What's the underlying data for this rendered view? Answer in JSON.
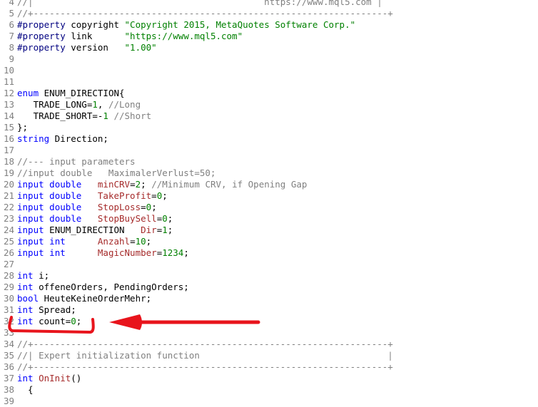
{
  "editor": {
    "lines": [
      {
        "n": "4",
        "segs": [
          {
            "t": "//|",
            "c": "cm"
          },
          {
            "t": "                                           https://www.mql5.com |",
            "c": "cm"
          }
        ]
      },
      {
        "n": "5",
        "segs": [
          {
            "t": "//+------------------------------------------------------------------+",
            "c": "cm"
          }
        ]
      },
      {
        "n": "6",
        "segs": [
          {
            "t": "#property",
            "c": "dir"
          },
          {
            "t": " copyright ",
            "c": ""
          },
          {
            "t": "\"Copyright 2015, MetaQuotes Software Corp.\"",
            "c": "str"
          }
        ]
      },
      {
        "n": "7",
        "segs": [
          {
            "t": "#property",
            "c": "dir"
          },
          {
            "t": " link      ",
            "c": ""
          },
          {
            "t": "\"https://www.mql5.com\"",
            "c": "str"
          }
        ]
      },
      {
        "n": "8",
        "segs": [
          {
            "t": "#property",
            "c": "dir"
          },
          {
            "t": " version   ",
            "c": ""
          },
          {
            "t": "\"1.00\"",
            "c": "str"
          }
        ]
      },
      {
        "n": "9",
        "segs": []
      },
      {
        "n": "10",
        "segs": []
      },
      {
        "n": "11",
        "segs": []
      },
      {
        "n": "12",
        "segs": [
          {
            "t": "enum",
            "c": "kw"
          },
          {
            "t": " ENUM_DIRECTION{",
            "c": ""
          }
        ]
      },
      {
        "n": "13",
        "segs": [
          {
            "t": "   TRADE_LONG=",
            "c": ""
          },
          {
            "t": "1",
            "c": "num"
          },
          {
            "t": ", ",
            "c": ""
          },
          {
            "t": "//Long",
            "c": "cm"
          }
        ]
      },
      {
        "n": "14",
        "segs": [
          {
            "t": "   TRADE_SHORT=-",
            "c": ""
          },
          {
            "t": "1",
            "c": "num"
          },
          {
            "t": " ",
            "c": ""
          },
          {
            "t": "//Short",
            "c": "cm"
          }
        ]
      },
      {
        "n": "15",
        "segs": [
          {
            "t": "};",
            "c": ""
          }
        ]
      },
      {
        "n": "16",
        "segs": [
          {
            "t": "string",
            "c": "kw"
          },
          {
            "t": " Direction;",
            "c": ""
          }
        ]
      },
      {
        "n": "17",
        "segs": []
      },
      {
        "n": "18",
        "segs": [
          {
            "t": "//--- input parameters",
            "c": "cm"
          }
        ]
      },
      {
        "n": "19",
        "segs": [
          {
            "t": "//input double   MaximalerVerlust=50;",
            "c": "cm"
          }
        ]
      },
      {
        "n": "20",
        "segs": [
          {
            "t": "input",
            "c": "kw"
          },
          {
            "t": " ",
            "c": ""
          },
          {
            "t": "double",
            "c": "kw"
          },
          {
            "t": "   ",
            "c": ""
          },
          {
            "t": "minCRV",
            "c": "id"
          },
          {
            "t": "=",
            "c": ""
          },
          {
            "t": "2",
            "c": "num"
          },
          {
            "t": "; ",
            "c": ""
          },
          {
            "t": "//Minimum CRV, if Opening Gap",
            "c": "cm"
          }
        ]
      },
      {
        "n": "21",
        "segs": [
          {
            "t": "input",
            "c": "kw"
          },
          {
            "t": " ",
            "c": ""
          },
          {
            "t": "double",
            "c": "kw"
          },
          {
            "t": "   ",
            "c": ""
          },
          {
            "t": "TakeProfit",
            "c": "id"
          },
          {
            "t": "=",
            "c": ""
          },
          {
            "t": "0",
            "c": "num"
          },
          {
            "t": ";",
            "c": ""
          }
        ]
      },
      {
        "n": "22",
        "segs": [
          {
            "t": "input",
            "c": "kw"
          },
          {
            "t": " ",
            "c": ""
          },
          {
            "t": "double",
            "c": "kw"
          },
          {
            "t": "   ",
            "c": ""
          },
          {
            "t": "StopLoss",
            "c": "id"
          },
          {
            "t": "=",
            "c": ""
          },
          {
            "t": "0",
            "c": "num"
          },
          {
            "t": ";",
            "c": ""
          }
        ]
      },
      {
        "n": "23",
        "segs": [
          {
            "t": "input",
            "c": "kw"
          },
          {
            "t": " ",
            "c": ""
          },
          {
            "t": "double",
            "c": "kw"
          },
          {
            "t": "   ",
            "c": ""
          },
          {
            "t": "StopBuySell",
            "c": "id"
          },
          {
            "t": "=",
            "c": ""
          },
          {
            "t": "0",
            "c": "num"
          },
          {
            "t": ";",
            "c": ""
          }
        ]
      },
      {
        "n": "24",
        "segs": [
          {
            "t": "input",
            "c": "kw"
          },
          {
            "t": " ENUM_DIRECTION   ",
            "c": ""
          },
          {
            "t": "Dir",
            "c": "id"
          },
          {
            "t": "=",
            "c": ""
          },
          {
            "t": "1",
            "c": "num"
          },
          {
            "t": ";",
            "c": ""
          }
        ]
      },
      {
        "n": "25",
        "segs": [
          {
            "t": "input",
            "c": "kw"
          },
          {
            "t": " ",
            "c": ""
          },
          {
            "t": "int",
            "c": "kw"
          },
          {
            "t": "      ",
            "c": ""
          },
          {
            "t": "Anzahl",
            "c": "id"
          },
          {
            "t": "=",
            "c": ""
          },
          {
            "t": "10",
            "c": "num"
          },
          {
            "t": ";",
            "c": ""
          }
        ]
      },
      {
        "n": "26",
        "segs": [
          {
            "t": "input",
            "c": "kw"
          },
          {
            "t": " ",
            "c": ""
          },
          {
            "t": "int",
            "c": "kw"
          },
          {
            "t": "      ",
            "c": ""
          },
          {
            "t": "MagicNumber",
            "c": "id"
          },
          {
            "t": "=",
            "c": ""
          },
          {
            "t": "1234",
            "c": "num"
          },
          {
            "t": ";",
            "c": ""
          }
        ]
      },
      {
        "n": "27",
        "segs": []
      },
      {
        "n": "28",
        "segs": [
          {
            "t": "int",
            "c": "kw"
          },
          {
            "t": " i;",
            "c": ""
          }
        ]
      },
      {
        "n": "29",
        "segs": [
          {
            "t": "int",
            "c": "kw"
          },
          {
            "t": " offeneOrders, PendingOrders;",
            "c": ""
          }
        ]
      },
      {
        "n": "30",
        "segs": [
          {
            "t": "bool",
            "c": "kw"
          },
          {
            "t": " HeuteKeineOrderMehr;",
            "c": ""
          }
        ]
      },
      {
        "n": "31",
        "segs": [
          {
            "t": "int",
            "c": "kw"
          },
          {
            "t": " Spread;",
            "c": ""
          }
        ]
      },
      {
        "n": "32",
        "segs": [
          {
            "t": "int",
            "c": "kw"
          },
          {
            "t": " count=",
            "c": ""
          },
          {
            "t": "0",
            "c": "num"
          },
          {
            "t": ";",
            "c": ""
          }
        ]
      },
      {
        "n": "33",
        "segs": []
      },
      {
        "n": "34",
        "segs": [
          {
            "t": "//+------------------------------------------------------------------+",
            "c": "cm"
          }
        ]
      },
      {
        "n": "35",
        "segs": [
          {
            "t": "//| Expert initialization function                                   |",
            "c": "cm"
          }
        ]
      },
      {
        "n": "36",
        "segs": [
          {
            "t": "//+------------------------------------------------------------------+",
            "c": "cm"
          }
        ]
      },
      {
        "n": "37",
        "segs": [
          {
            "t": "int",
            "c": "kw"
          },
          {
            "t": " ",
            "c": ""
          },
          {
            "t": "OnInit",
            "c": "fn"
          },
          {
            "t": "()",
            "c": ""
          }
        ]
      },
      {
        "n": "38",
        "segs": [
          {
            "t": "  {",
            "c": ""
          }
        ]
      },
      {
        "n": "39",
        "segs": []
      }
    ]
  },
  "annotation": {
    "color": "#e8141c",
    "shapes": [
      "bracket-underline",
      "arrow-left"
    ]
  }
}
